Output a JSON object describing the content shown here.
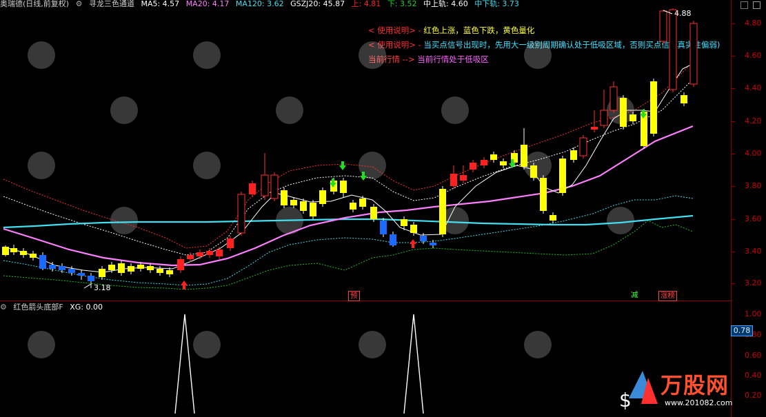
{
  "header": {
    "stock": "奥瑞德(日线,前复权)",
    "indicator": "寻龙三色通道",
    "ma5": "MA5: 4.57",
    "ma20": "MA20: 4.17",
    "ma120": "MA120: 3.62",
    "gszj": "GSZJ20: 45.87",
    "up": "上: 4.81",
    "down": "下: 3.52",
    "mid_up": "中上轨: 4.60",
    "mid_down": "中下轨: 3.73"
  },
  "notes": {
    "line1_prefix": "< 使用说明> -",
    "line1_text": "红色上涨，蓝色下跌，黄色量化",
    "line2_prefix": "< 使用说明> -",
    "line2_text": "当买点信号出现时，先用大一级别周期确认处于低吸区域，否则买点信号真实性偏弱)",
    "line3_prefix": "当前行情 -->",
    "line3_text": "当前行情处于低吸区"
  },
  "annotations": {
    "low": "3.18",
    "high": "4.88",
    "tag_yu": "预",
    "tag_jian": "减",
    "tag_zhangbang": "涨榜"
  },
  "lower_panel": {
    "title": "红色箭头底部F",
    "xg": "XG: 0.00",
    "current_value": "0.78"
  },
  "axis_main": [
    "4.80",
    "4.60",
    "4.40",
    "4.20",
    "4.00",
    "3.80",
    "3.60",
    "3.40",
    "3.20"
  ],
  "axis_sub": [
    "1.00",
    "0.80",
    "0.60",
    "0.40",
    "0.20"
  ],
  "watermark": {
    "brand": "万股网",
    "url": "www.201082.com"
  },
  "colors": {
    "up": "#ff2020",
    "down": "#1a6aff",
    "neutral": "#ffff00",
    "ma_cyan": "#40e0f0",
    "ma_pink": "#ff80ff",
    "bg": "#000000"
  }
}
